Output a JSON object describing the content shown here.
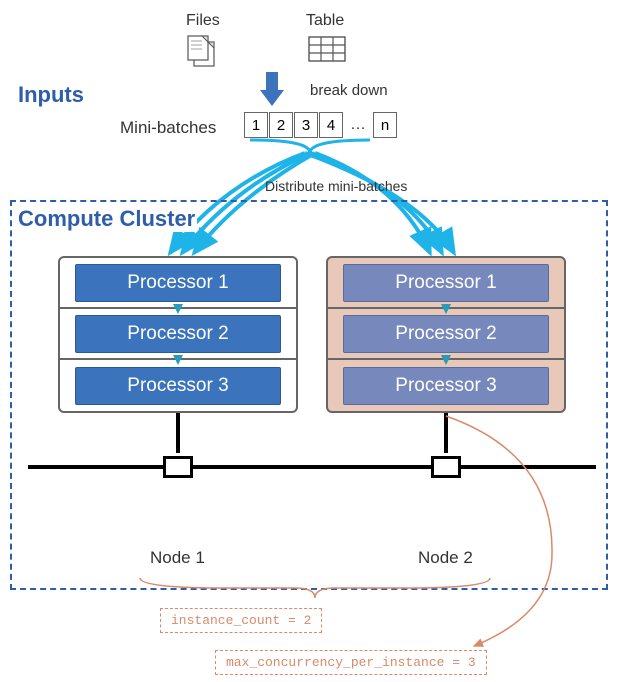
{
  "labels": {
    "inputs": "Inputs",
    "files": "Files",
    "table": "Table",
    "break_down": "break down",
    "minibatches": "Mini-batches",
    "distribute": "Distribute mini-batches",
    "cluster": "Compute Cluster",
    "node1": "Node 1",
    "node2": "Node 2",
    "instance_count": "instance_count = 2",
    "max_concurrency": "max_concurrency_per_instance = 3"
  },
  "batches": {
    "b1": "1",
    "b2": "2",
    "b3": "3",
    "b4": "4",
    "dots": "…",
    "bn": "n"
  },
  "server1": {
    "p1": "Processor 1",
    "p2": "Processor 2",
    "p3": "Processor 3"
  },
  "server2": {
    "p1": "Processor 1",
    "p2": "Processor 2",
    "p3": "Processor 3"
  },
  "chart_data": {
    "type": "table",
    "title": "Batch processing architecture diagram",
    "nodes": 2,
    "processors_per_node": 3,
    "mini_batches_shown": [
      "1",
      "2",
      "3",
      "4",
      "…",
      "n"
    ],
    "config": {
      "instance_count": 2,
      "max_concurrency_per_instance": 3
    }
  }
}
